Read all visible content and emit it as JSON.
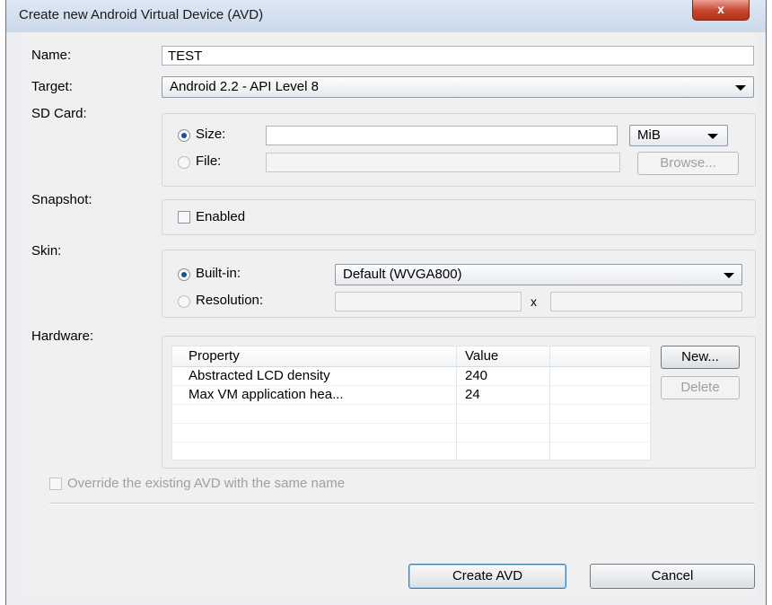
{
  "window": {
    "title": "Create new Android Virtual Device (AVD)",
    "close_glyph": "x"
  },
  "name": {
    "label": "Name:",
    "value": "TEST"
  },
  "target": {
    "label": "Target:",
    "value": "Android 2.2 - API Level 8"
  },
  "sdcard": {
    "label": "SD Card:",
    "size_label": "Size:",
    "size_value": "",
    "unit": "MiB",
    "file_label": "File:",
    "file_value": "",
    "browse": "Browse..."
  },
  "snapshot": {
    "label": "Snapshot:",
    "enabled_label": "Enabled"
  },
  "skin": {
    "label": "Skin:",
    "builtin_label": "Built-in:",
    "builtin_value": "Default (WVGA800)",
    "resolution_label": "Resolution:",
    "x_label": "x"
  },
  "hardware": {
    "label": "Hardware:",
    "columns": [
      "Property",
      "Value"
    ],
    "rows": [
      {
        "property": "Abstracted LCD density",
        "value": "240"
      },
      {
        "property": "Max VM application hea...",
        "value": "24"
      }
    ],
    "new_button": "New...",
    "delete_button": "Delete"
  },
  "override": {
    "label": "Override the existing AVD with the same name"
  },
  "actions": {
    "create": "Create AVD",
    "cancel": "Cancel"
  }
}
